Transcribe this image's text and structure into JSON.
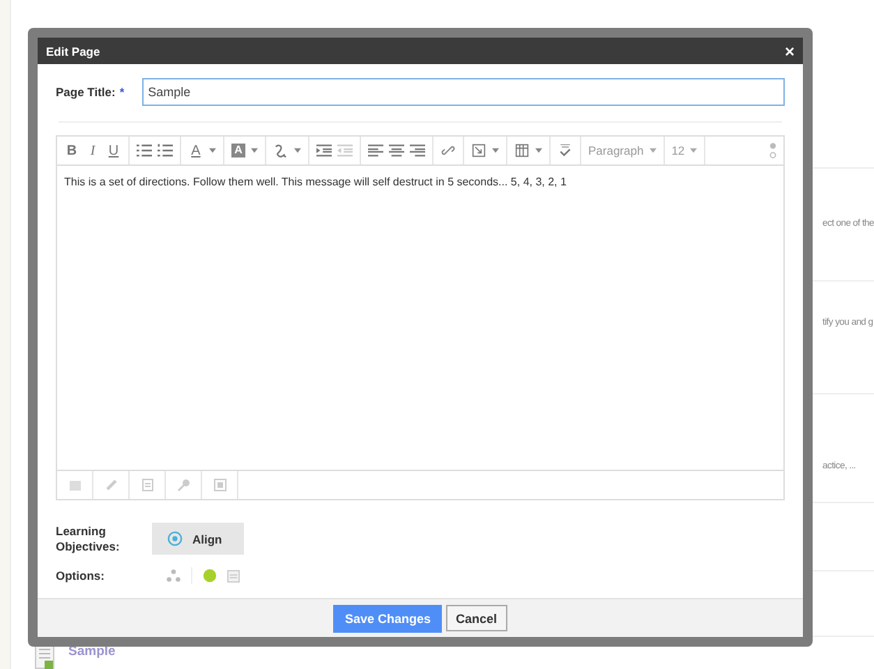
{
  "background": {
    "rows": [
      "ect one of the",
      "tify you and g",
      "actice, ..."
    ],
    "item": {
      "title": "Sample"
    }
  },
  "dialog": {
    "title": "Edit Page",
    "close": "×",
    "page_title": {
      "label": "Page Title:",
      "required": "*",
      "value": "Sample"
    },
    "editor": {
      "bold": "B",
      "italic": "I",
      "underline": "U",
      "font_color": "A",
      "bg_color": "A",
      "format": "Paragraph",
      "size": "12",
      "content": "This is a set of directions. Follow them well. This message will self destruct in 5 seconds... 5, 4, 3, 2, 1"
    },
    "objectives": {
      "label": "Learning Objectives:",
      "button": "Align"
    },
    "options": {
      "label": "Options:"
    },
    "buttons": {
      "save": "Save Changes",
      "cancel": "Cancel"
    }
  }
}
